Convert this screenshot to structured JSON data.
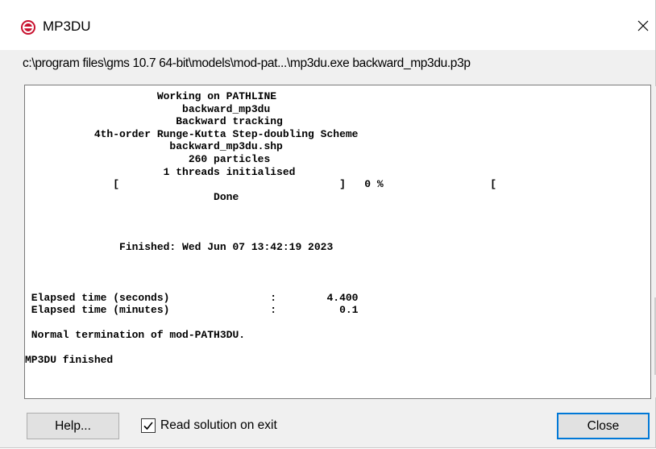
{
  "window": {
    "title": "MP3DU",
    "close_glyph": "×"
  },
  "command_line": "c:\\program files\\gms 10.7 64-bit\\models\\mod-pat...\\mp3du.exe backward_mp3du.p3p",
  "console": {
    "lines": [
      "                     Working on PATHLINE",
      "                         backward_mp3du",
      "                        Backward tracking",
      "           4th-order Runge-Kutta Step-doubling Scheme",
      "                       backward_mp3du.shp",
      "                          260 particles",
      "                      1 threads initialised",
      "              [                                   ]   0 %                 [",
      "                              Done",
      "",
      "",
      "",
      "               Finished: Wed Jun 07 13:42:19 2023",
      "",
      "",
      "",
      " Elapsed time (seconds)                :        4.400",
      " Elapsed time (minutes)                :          0.1",
      "",
      " Normal termination of mod-PATH3DU.",
      "",
      "MP3DU finished"
    ]
  },
  "buttons": {
    "help": "Help...",
    "close": "Close"
  },
  "checkbox": {
    "label": "Read solution on exit",
    "checked": true
  },
  "colors": {
    "window_bg": "#f0f0f0",
    "focus_border": "#0078d7",
    "app_icon": "#c8102e"
  },
  "icons": {
    "app": "mp3du-app-icon",
    "close": "close-icon",
    "scroll_up": "chevron-up-icon",
    "scroll_down": "chevron-down-icon",
    "check": "checkmark-icon"
  }
}
